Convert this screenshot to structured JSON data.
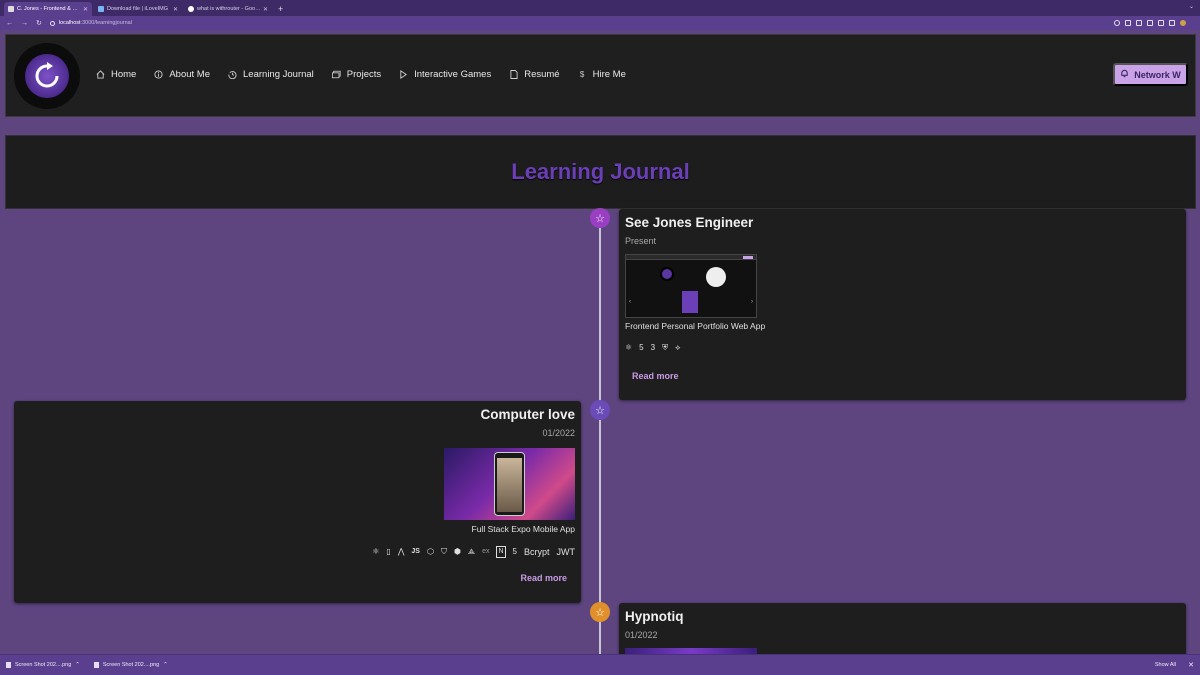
{
  "browser": {
    "tabs": [
      {
        "title": "C. Jones - Frontend & Fullstack",
        "active": true
      },
      {
        "title": "Download file | iLoveIMG",
        "active": false
      },
      {
        "title": "what is withrouter - Google Se...",
        "active": false
      }
    ],
    "new_tab": "+",
    "url_host": "localhost",
    "url_path": ":3000/learningjournal"
  },
  "header": {
    "nav": [
      {
        "label": "Home",
        "icon": "home-icon"
      },
      {
        "label": "About Me",
        "icon": "info-icon"
      },
      {
        "label": "Learning Journal",
        "icon": "history-icon"
      },
      {
        "label": "Projects",
        "icon": "images-icon"
      },
      {
        "label": "Interactive Games",
        "icon": "play-icon"
      },
      {
        "label": "Resumé",
        "icon": "document-icon"
      },
      {
        "label": "Hire Me",
        "icon": "dollar-icon"
      }
    ],
    "network_button": "Network W"
  },
  "page": {
    "title": "Learning Journal"
  },
  "timeline": {
    "entries": [
      {
        "title": "See Jones Engineer",
        "date": "Present",
        "description": "Frontend Personal Portfolio Web App",
        "tech": [
          "⚛",
          "5",
          "3",
          "⛨",
          "⟡"
        ],
        "read_more": "Read more",
        "dot_color": "#9a3fc2"
      },
      {
        "title": "Computer love",
        "date": "01/2022",
        "description": "Full Stack Expo Mobile App",
        "tech": [
          "⚛",
          "▯",
          "⋀",
          "JS",
          "⬡",
          "⛉",
          "⬢",
          "⟁",
          "ex",
          "N",
          "5",
          "Bcrypt",
          "JWT"
        ],
        "read_more": "Read more",
        "dot_color": "#6a4bb8"
      },
      {
        "title": "Hypnotiq",
        "date": "01/2022",
        "dot_color": "#e0902a"
      }
    ]
  },
  "downloads": {
    "items": [
      "Screen Shot 202....png",
      "Screen Shot 202....png"
    ],
    "show_all": "Show All"
  }
}
